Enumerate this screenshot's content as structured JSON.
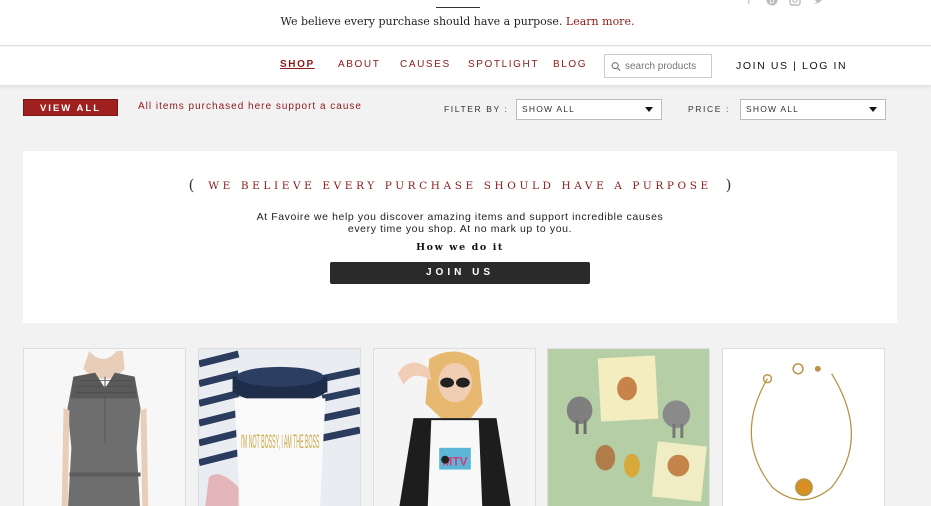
{
  "topbar": {
    "tagline": "We believe every purchase should have a purpose.",
    "learn_more": "Learn more.",
    "social_icons": [
      "facebook-icon",
      "pinterest-icon",
      "instagram-icon",
      "twitter-icon"
    ]
  },
  "nav": {
    "items": [
      "SHOP",
      "ABOUT",
      "CAUSES",
      "SPOTLIGHT",
      "BLOG"
    ],
    "active": "SHOP",
    "search_placeholder": "search products",
    "join": "JOIN US",
    "separator": "|",
    "login": "LOG IN"
  },
  "filterbar": {
    "view_all": "VIEW ALL",
    "all_items": "All items purchased here support a cause",
    "filter_label": "FILTER BY :",
    "filter_value": "SHOW ALL",
    "price_label": "PRICE :",
    "price_value": "SHOW ALL"
  },
  "hero": {
    "open_bracket": "(",
    "headline": "WE BELIEVE EVERY PURCHASE SHOULD HAVE A PURPOSE",
    "close_bracket": ")",
    "desc_line1": "At Favoire we help you discover amazing items and support incredible causes",
    "desc_line2": "every time you shop. At no mark up to you.",
    "how": "How we do it",
    "join_button": "JOIN US"
  },
  "products": {
    "items": [
      {
        "image": "gray-lace-dress"
      },
      {
        "image": "travel-mug",
        "print": "I'M NOT BOSSY, I AM THE BOSS"
      },
      {
        "image": "woman-mtv-shirt",
        "print": "MTV"
      },
      {
        "image": "animal-butt-magnets"
      },
      {
        "image": "gold-bracelet"
      }
    ]
  },
  "colors": {
    "accent": "#8b1a1a",
    "view_all_bg": "#a01f1f",
    "join_button_bg": "#2a2a2a",
    "page_bg": "#f2f2f2"
  }
}
